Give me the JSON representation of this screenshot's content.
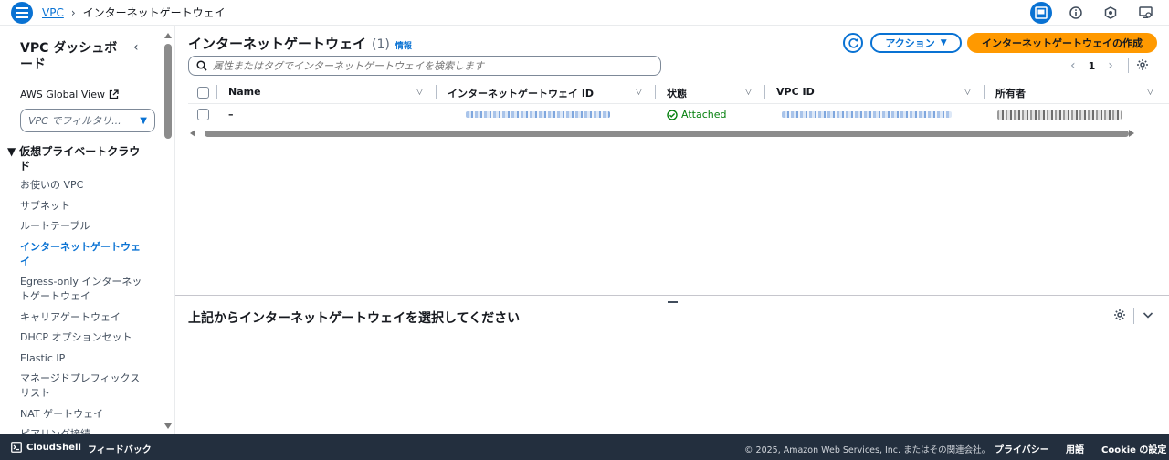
{
  "header": {
    "breadcrumb": {
      "service": "VPC",
      "current": "インターネットゲートウェイ"
    }
  },
  "sidebar": {
    "title": "VPC ダッシュボード",
    "aws_global_view": "AWS Global View",
    "filter_placeholder": "VPC でフィルタリ...",
    "section": "仮想プライベートクラウド",
    "items": [
      {
        "label": "お使いの VPC"
      },
      {
        "label": "サブネット"
      },
      {
        "label": "ルートテーブル"
      },
      {
        "label": "インターネットゲートウェイ",
        "active": true
      },
      {
        "label": "Egress-only インターネットゲートウェイ"
      },
      {
        "label": "キャリアゲートウェイ"
      },
      {
        "label": "DHCP オプションセット"
      },
      {
        "label": "Elastic IP"
      },
      {
        "label": "マネージドプレフィックスリスト"
      },
      {
        "label": "NAT ゲートウェイ"
      },
      {
        "label": "ピアリング接続"
      }
    ]
  },
  "main": {
    "title": "インターネットゲートウェイ",
    "count": "(1)",
    "info": "情報",
    "actions_label": "アクション",
    "create_label": "インターネットゲートウェイの作成",
    "search_placeholder": "属性またはタグでインターネットゲートウェイを検索します",
    "current_page": "1",
    "columns": [
      "Name",
      "インターネットゲートウェイ ID",
      "状態",
      "VPC ID",
      "所有者"
    ],
    "rows": [
      {
        "name": "–",
        "state": "Attached"
      }
    ]
  },
  "split_panel": {
    "title": "上記からインターネットゲートウェイを選択してください"
  },
  "footer": {
    "cloudshell": "CloudShell",
    "feedback": "フィードバック",
    "copyright": "© 2025, Amazon Web Services, Inc. またはその関連会社。",
    "privacy": "プライバシー",
    "terms": "用語",
    "cookie": "Cookie の設定"
  },
  "colors": {
    "accent": "#0972d3",
    "primary_button": "#ff9900",
    "success": "#037f0c",
    "footer_bg": "#232f3e"
  }
}
